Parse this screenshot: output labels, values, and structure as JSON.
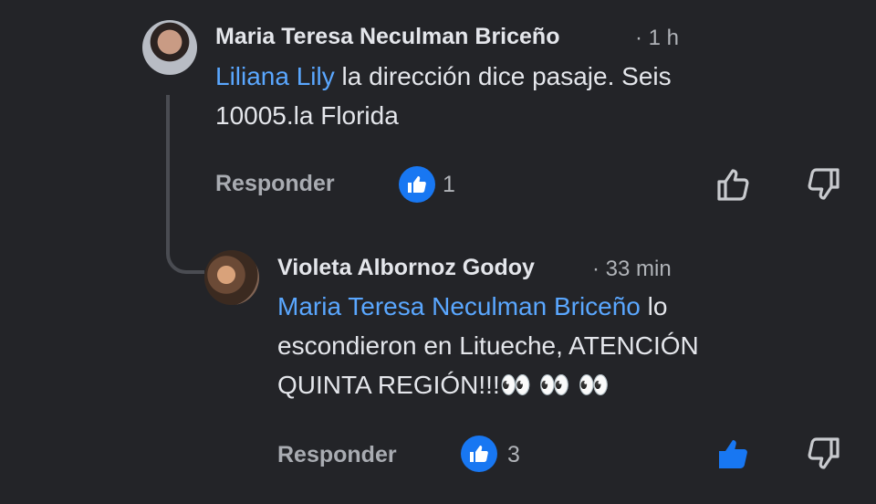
{
  "comment": {
    "author": "Maria Teresa Neculman Briceño",
    "time": "· 1 h",
    "mention": "Liliana Lily",
    "text_line1_rest": " la dirección dice pasaje. Seis",
    "text_line2": "10005.la Florida",
    "reply_label": "Responder",
    "like_count": "1"
  },
  "reply": {
    "author": "Violeta Albornoz Godoy",
    "time": "· 33 min",
    "mention": "Maria Teresa Neculman Briceño",
    "text_line1_rest": " lo",
    "text_line2": "escondieron en Litueche, ATENCIÓN",
    "text_line3": "QUINTA REGIÓN!!!👀 👀 👀",
    "reply_label": "Responder",
    "like_count": "3"
  },
  "colors": {
    "background": "#232428",
    "mention": "#5aa7ff",
    "like_blue": "#1877f2"
  },
  "icons": {
    "like_reaction": "thumbs-up-icon",
    "like_action": "thumbs-up-outline-icon",
    "like_action_active": "thumbs-up-filled-icon",
    "dislike_action": "thumbs-down-outline-icon"
  }
}
